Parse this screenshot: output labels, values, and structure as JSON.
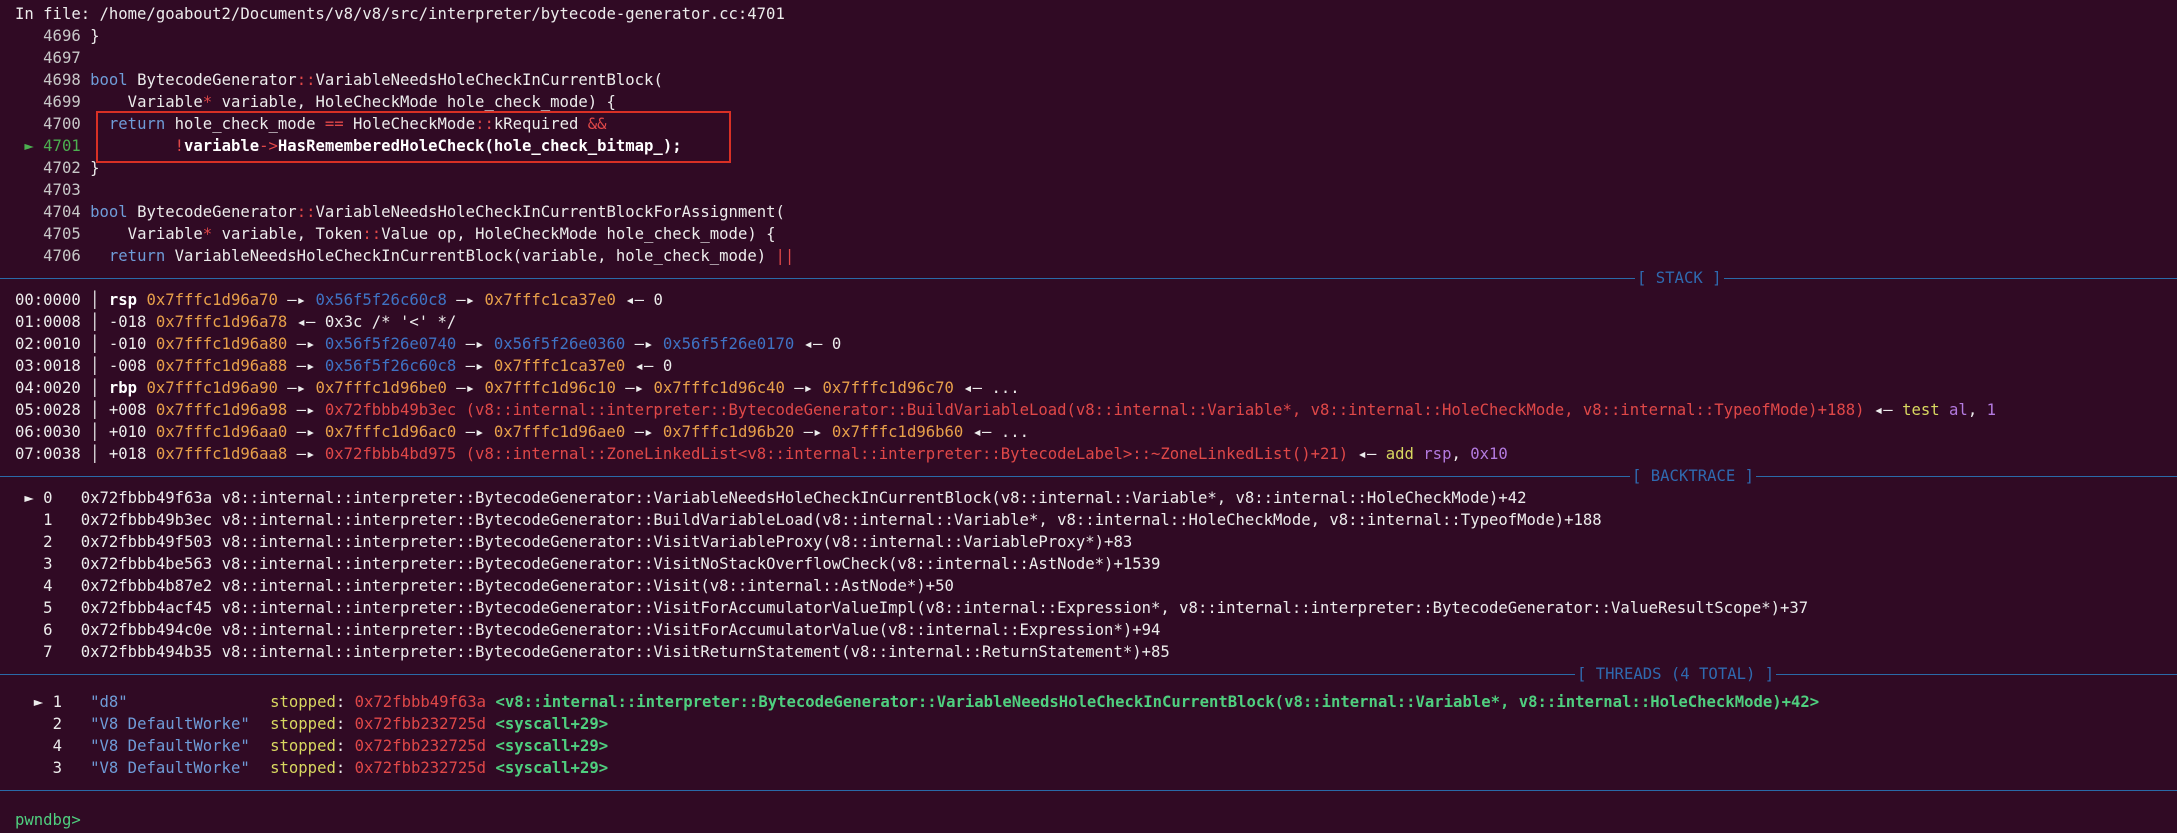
{
  "header": "In file: /home/goabout2/Documents/v8/v8/src/interpreter/bytecode-generator.cc:4701",
  "source": [
    {
      "num": "4696",
      "parts": [
        [
          "}",
          "white"
        ]
      ]
    },
    {
      "num": "4697",
      "parts": []
    },
    {
      "num": "4698",
      "parts": [
        [
          "bool",
          "kw"
        ],
        [
          " BytecodeGenerator",
          "white"
        ],
        [
          "::",
          "op"
        ],
        [
          "VariableNeedsHoleCheckInCurrentBlock(",
          "white"
        ]
      ]
    },
    {
      "num": "4699",
      "parts": [
        [
          "    Variable",
          "white"
        ],
        [
          "*",
          "op"
        ],
        [
          " variable, HoleCheckMode hole_check_mode) {",
          "white"
        ]
      ]
    },
    {
      "num": "4700",
      "parts": [
        [
          "  ",
          "white"
        ],
        [
          "return",
          "kw"
        ],
        [
          " hole_check_mode ",
          "white"
        ],
        [
          "==",
          "op"
        ],
        [
          " HoleCheckMode",
          "white"
        ],
        [
          "::",
          "op"
        ],
        [
          "kRequired ",
          "white"
        ],
        [
          "&&",
          "op"
        ]
      ]
    },
    {
      "num": "4701",
      "current": true,
      "marker": "►",
      "parts": [
        [
          "         ",
          "white"
        ],
        [
          "!",
          "op"
        ],
        [
          "variable",
          "bold"
        ],
        [
          "->",
          "op"
        ],
        [
          "HasRememberedHoleCheck(hole_check_bitmap_);",
          "bold"
        ]
      ]
    },
    {
      "num": "4702",
      "parts": [
        [
          "}",
          "white"
        ]
      ]
    },
    {
      "num": "4703",
      "parts": []
    },
    {
      "num": "4704",
      "parts": [
        [
          "bool",
          "kw"
        ],
        [
          " BytecodeGenerator",
          "white"
        ],
        [
          "::",
          "op"
        ],
        [
          "VariableNeedsHoleCheckInCurrentBlockForAssignment(",
          "white"
        ]
      ]
    },
    {
      "num": "4705",
      "parts": [
        [
          "    Variable",
          "white"
        ],
        [
          "*",
          "op"
        ],
        [
          " variable, Token",
          "white"
        ],
        [
          "::",
          "op"
        ],
        [
          "Value op, HoleCheckMode hole_check_mode) {",
          "white"
        ]
      ]
    },
    {
      "num": "4706",
      "parts": [
        [
          "  ",
          "white"
        ],
        [
          "return",
          "kw"
        ],
        [
          " VariableNeedsHoleCheckInCurrentBlock(variable, hole_check_mode) ",
          "white"
        ],
        [
          "||",
          "op"
        ]
      ]
    }
  ],
  "sections": {
    "stack": "[ STACK ]",
    "backtrace": "[ BACKTRACE ]",
    "threads": "[ THREADS (4 TOTAL) ]"
  },
  "stack": [
    {
      "index": "00:0000",
      "reg": "rsp",
      "parts": [
        [
          "0x7fffc1d96a70",
          "stack"
        ],
        [
          " —▸ ",
          "white"
        ],
        [
          "0x56f5f26c60c8",
          "heap"
        ],
        [
          " —▸ ",
          "white"
        ],
        [
          "0x7fffc1ca37e0",
          "stack"
        ],
        [
          " ◂— 0",
          "white"
        ]
      ]
    },
    {
      "index": "01:0008",
      "reg": "-018",
      "parts": [
        [
          "0x7fffc1d96a78",
          "stack"
        ],
        [
          " ◂— 0x3c /* '<' */",
          "white"
        ]
      ]
    },
    {
      "index": "02:0010",
      "reg": "-010",
      "parts": [
        [
          "0x7fffc1d96a80",
          "stack"
        ],
        [
          " —▸ ",
          "white"
        ],
        [
          "0x56f5f26e0740",
          "heap"
        ],
        [
          " —▸ ",
          "white"
        ],
        [
          "0x56f5f26e0360",
          "heap"
        ],
        [
          " —▸ ",
          "white"
        ],
        [
          "0x56f5f26e0170",
          "heap"
        ],
        [
          " ◂— 0",
          "white"
        ]
      ]
    },
    {
      "index": "03:0018",
      "reg": "-008",
      "parts": [
        [
          "0x7fffc1d96a88",
          "stack"
        ],
        [
          " —▸ ",
          "white"
        ],
        [
          "0x56f5f26c60c8",
          "heap"
        ],
        [
          " —▸ ",
          "white"
        ],
        [
          "0x7fffc1ca37e0",
          "stack"
        ],
        [
          " ◂— 0",
          "white"
        ]
      ]
    },
    {
      "index": "04:0020",
      "reg": "rbp",
      "parts": [
        [
          "0x7fffc1d96a90",
          "stack"
        ],
        [
          " —▸ ",
          "white"
        ],
        [
          "0x7fffc1d96be0",
          "stack"
        ],
        [
          " —▸ ",
          "white"
        ],
        [
          "0x7fffc1d96c10",
          "stack"
        ],
        [
          " —▸ ",
          "white"
        ],
        [
          "0x7fffc1d96c40",
          "stack"
        ],
        [
          " —▸ ",
          "white"
        ],
        [
          "0x7fffc1d96c70",
          "stack"
        ],
        [
          " ◂— ...",
          "white"
        ]
      ]
    },
    {
      "index": "05:0028",
      "reg": "+008",
      "parts": [
        [
          "0x7fffc1d96a98",
          "stack"
        ],
        [
          " —▸ ",
          "white"
        ],
        [
          "0x72fbbb49b3ec (v8::internal::interpreter::BytecodeGenerator::BuildVariableLoad(v8::internal::Variable*, v8::internal::HoleCheckMode, v8::internal::TypeofMode)+188)",
          "code"
        ],
        [
          " ◂— ",
          "white"
        ],
        [
          "test",
          "ins"
        ],
        [
          " al",
          "data"
        ],
        [
          ", ",
          "white"
        ],
        [
          "1",
          "data"
        ]
      ]
    },
    {
      "index": "06:0030",
      "reg": "+010",
      "parts": [
        [
          "0x7fffc1d96aa0",
          "stack"
        ],
        [
          " —▸ ",
          "white"
        ],
        [
          "0x7fffc1d96ac0",
          "stack"
        ],
        [
          " —▸ ",
          "white"
        ],
        [
          "0x7fffc1d96ae0",
          "stack"
        ],
        [
          " —▸ ",
          "white"
        ],
        [
          "0x7fffc1d96b20",
          "stack"
        ],
        [
          " —▸ ",
          "white"
        ],
        [
          "0x7fffc1d96b60",
          "stack"
        ],
        [
          " ◂— ...",
          "white"
        ]
      ]
    },
    {
      "index": "07:0038",
      "reg": "+018",
      "parts": [
        [
          "0x7fffc1d96aa8",
          "stack"
        ],
        [
          " —▸ ",
          "white"
        ],
        [
          "0x72fbbb4bd975 (v8::internal::ZoneLinkedList<v8::internal::interpreter::BytecodeLabel>::~ZoneLinkedList()+21)",
          "code"
        ],
        [
          " ◂— ",
          "white"
        ],
        [
          "add",
          "ins"
        ],
        [
          " rsp",
          "data"
        ],
        [
          ", ",
          "white"
        ],
        [
          "0x10",
          "data"
        ]
      ]
    }
  ],
  "backtrace": [
    {
      "marker": "►",
      "idx": "0",
      "addr": "0x72fbbb49f63a",
      "fn": "v8::internal::interpreter::BytecodeGenerator::VariableNeedsHoleCheckInCurrentBlock(v8::internal::Variable*, v8::internal::HoleCheckMode)+42"
    },
    {
      "marker": "",
      "idx": "1",
      "addr": "0x72fbbb49b3ec",
      "fn": "v8::internal::interpreter::BytecodeGenerator::BuildVariableLoad(v8::internal::Variable*, v8::internal::HoleCheckMode, v8::internal::TypeofMode)+188"
    },
    {
      "marker": "",
      "idx": "2",
      "addr": "0x72fbbb49f503",
      "fn": "v8::internal::interpreter::BytecodeGenerator::VisitVariableProxy(v8::internal::VariableProxy*)+83"
    },
    {
      "marker": "",
      "idx": "3",
      "addr": "0x72fbbb4be563",
      "fn": "v8::internal::interpreter::BytecodeGenerator::VisitNoStackOverflowCheck(v8::internal::AstNode*)+1539"
    },
    {
      "marker": "",
      "idx": "4",
      "addr": "0x72fbbb4b87e2",
      "fn": "v8::internal::interpreter::BytecodeGenerator::Visit(v8::internal::AstNode*)+50"
    },
    {
      "marker": "",
      "idx": "5",
      "addr": "0x72fbbb4acf45",
      "fn": "v8::internal::interpreter::BytecodeGenerator::VisitForAccumulatorValueImpl(v8::internal::Expression*, v8::internal::interpreter::BytecodeGenerator::ValueResultScope*)+37"
    },
    {
      "marker": "",
      "idx": "6",
      "addr": "0x72fbbb494c0e",
      "fn": "v8::internal::interpreter::BytecodeGenerator::VisitForAccumulatorValue(v8::internal::Expression*)+94"
    },
    {
      "marker": "",
      "idx": "7",
      "addr": "0x72fbbb494b35",
      "fn": "v8::internal::interpreter::BytecodeGenerator::VisitReturnStatement(v8::internal::ReturnStatement*)+85"
    }
  ],
  "threads": [
    {
      "marker": "►",
      "id": "1",
      "name": "\"d8\"",
      "state": "stopped",
      "addr": "0x72fbbb49f63a",
      "sym": "<v8::internal::interpreter::BytecodeGenerator::VariableNeedsHoleCheckInCurrentBlock(v8::internal::Variable*, v8::internal::HoleCheckMode)+42>"
    },
    {
      "marker": "",
      "id": "2",
      "name": "\"V8 DefaultWorke\"",
      "state": "stopped",
      "addr": "0x72fbb232725d",
      "sym": "<syscall+29>"
    },
    {
      "marker": "",
      "id": "4",
      "name": "\"V8 DefaultWorke\"",
      "state": "stopped",
      "addr": "0x72fbb232725d",
      "sym": "<syscall+29>"
    },
    {
      "marker": "",
      "id": "3",
      "name": "\"V8 DefaultWorke\"",
      "state": "stopped",
      "addr": "0x72fbb232725d",
      "sym": "<syscall+29>"
    }
  ],
  "prompt": "pwndbg>",
  "colors": {
    "background": "#300a24",
    "separator": "#2a6aa8",
    "highlight_box": "#d93025",
    "current_line": "#4caf50"
  }
}
